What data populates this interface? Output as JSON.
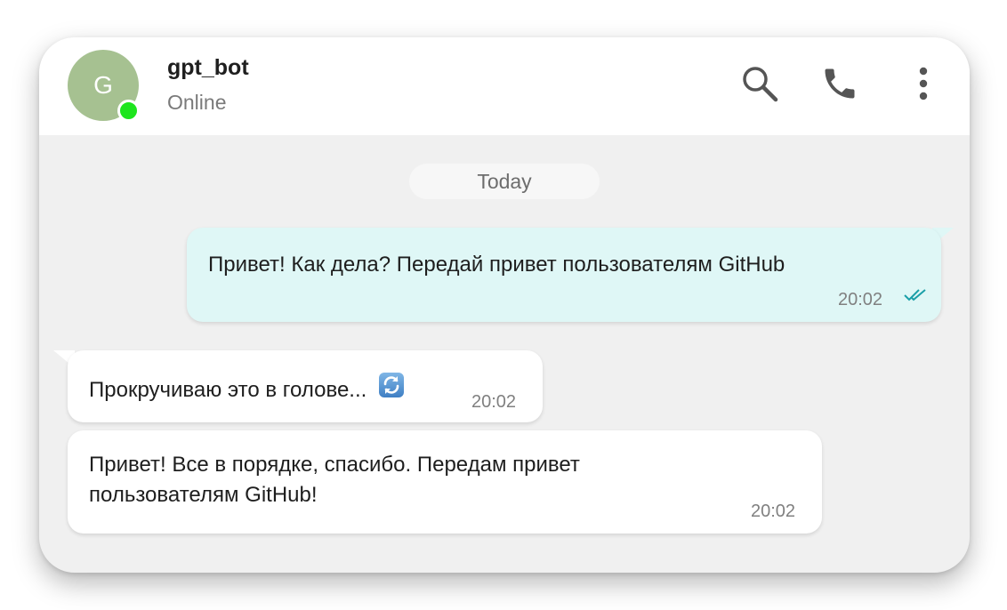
{
  "contact": {
    "avatar_letter": "G",
    "name": "gpt_bot",
    "status": "Online"
  },
  "header_icons": [
    "search-icon",
    "phone-icon",
    "more-vertical-icon"
  ],
  "date_separator": "Today",
  "colors": {
    "chat_background": "#f0f0f0",
    "outgoing_bubble": "#dff7f6",
    "incoming_bubble": "#ffffff",
    "avatar": "#a6c191",
    "online_indicator": "#1ee51e",
    "read_checkmarks": "#1a9fa8"
  },
  "messages": [
    {
      "direction": "outgoing",
      "text": "Привет! Как дела? Передай привет пользователям GitHub",
      "time": "20:02",
      "status_icon": "double-check-icon"
    },
    {
      "direction": "incoming",
      "text": "Прокручиваю это в голове...",
      "emoji": "refresh-emoji",
      "time": "20:02"
    },
    {
      "direction": "incoming",
      "text_lines": [
        "Привет! Все в порядке, спасибо. Передам привет",
        "пользователям GitHub!"
      ],
      "time": "20:02"
    }
  ]
}
